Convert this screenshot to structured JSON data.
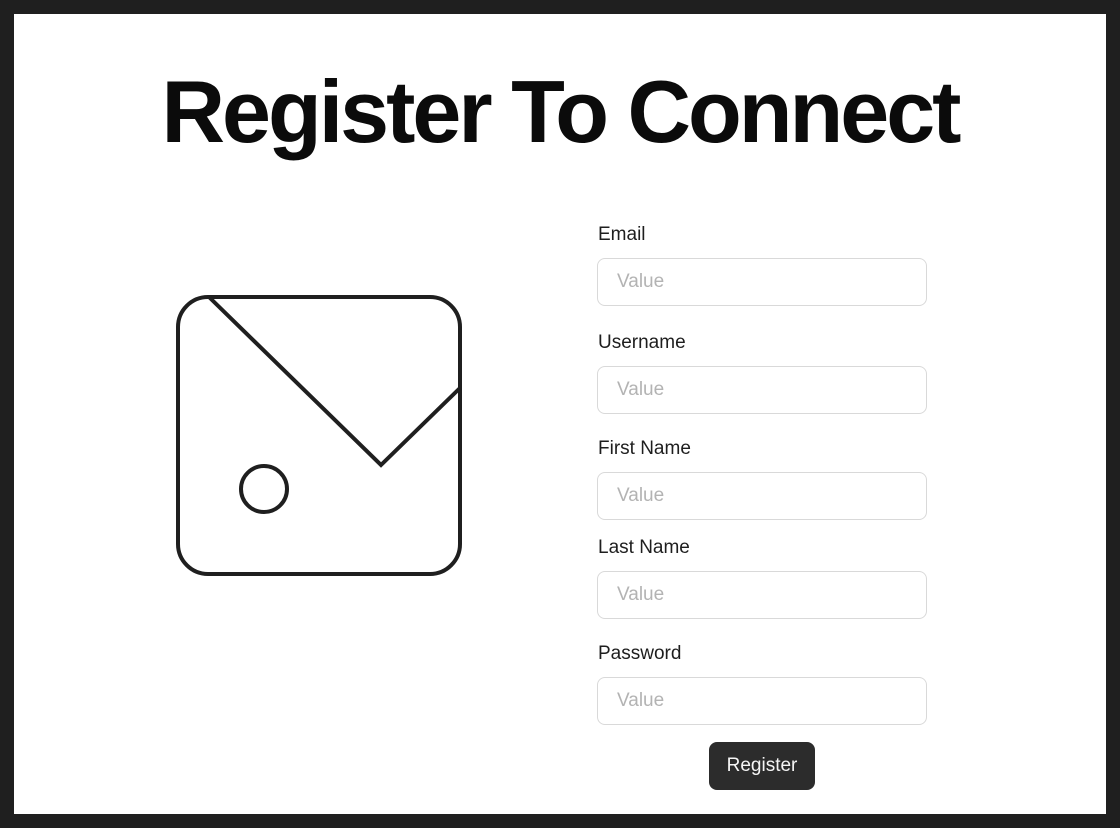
{
  "page": {
    "title": "Register To Connect"
  },
  "image": {
    "icon": "image-placeholder-icon"
  },
  "form": {
    "fields": [
      {
        "label": "Email",
        "placeholder": "Value",
        "value": ""
      },
      {
        "label": "Username",
        "placeholder": "Value",
        "value": ""
      },
      {
        "label": "First Name",
        "placeholder": "Value",
        "value": ""
      },
      {
        "label": "Last Name",
        "placeholder": "Value",
        "value": ""
      },
      {
        "label": "Password",
        "placeholder": "Value",
        "value": ""
      }
    ],
    "submit_label": "Register"
  },
  "colors": {
    "background": "#ffffff",
    "frame": "#1f1f1f",
    "button": "#2c2c2c",
    "button_text": "#f5f5f5",
    "input_border": "#d9d9d9",
    "placeholder": "#b3b3b3"
  }
}
